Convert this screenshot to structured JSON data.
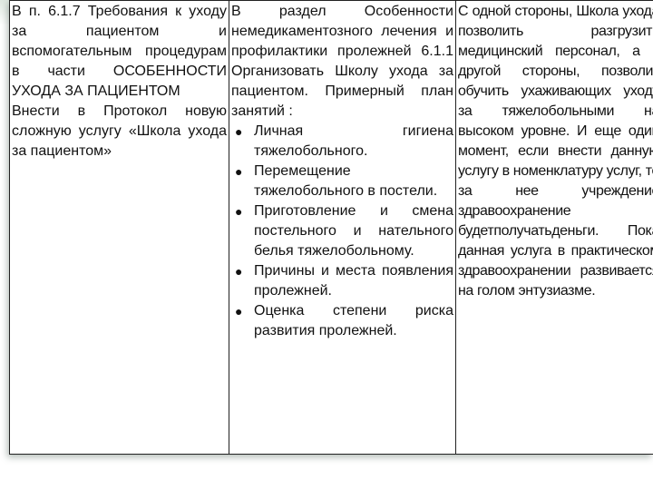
{
  "column1": {
    "paragraph1": "В п. 6.1.7 Требования к уходу за пациентом и вспомогательным процедурам в части ОСОБЕННОСТИ УХОДА ЗА ПАЦИЕНТОМ",
    "paragraph2": "Внести в Протокол новую сложную услугу «Школа ухода за пациентом»"
  },
  "column2": {
    "intro": "В раздел Особенности немедикаментозного лечения и профилактики пролежней 6.1.1 Организовать Школу ухода за пациентом. Примерный план занятий :",
    "items": [
      "Личная гигиена тяжелобольного.",
      "Перемещение тяжелобольного в постели.",
      "Приготовление и смена постельного и нательного белья тяжелобольному.",
      "Причины и места появления пролежней.",
      "Оценка степени риска развития пролежней."
    ],
    "bullet_icon": "bullet-dot-icon"
  },
  "column3": {
    "paragraph1": "С одной стороны, Школа ухода позволить разгрузить медицинский персонал, а с другой стороны, позволит обучить ухаживающих уходу за тяжелобольными на высоком уровне. И еще один момент, если внести данную услугу в номенклатуру услуг, то за нее учреждение здравоохранение будетполучатьденьги. Пока данная услуга в практическом здравоохранении развивается на голом энтузиазме."
  },
  "colors": {
    "border": "#222222",
    "text": "#111111",
    "top_band": "#dfe8e0",
    "shadow": "#5a6e64"
  }
}
